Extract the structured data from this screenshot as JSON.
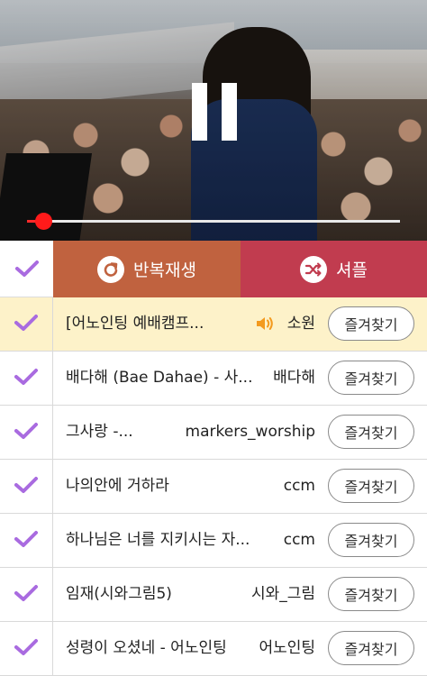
{
  "player": {
    "progress_fraction": 0.043
  },
  "controls": {
    "repeat_label": "반복재생",
    "shuffle_label": "셔플",
    "repeat_color": "#c0623f",
    "shuffle_color": "#c13c4f",
    "check_color": "#a96be0"
  },
  "tracks": [
    {
      "title": "[어노인팅 예배캠프...",
      "artist": "소원",
      "fav_label": "즐겨찾기",
      "active": true
    },
    {
      "title": "배다해 (Bae Dahae) - 사...",
      "artist": "배다해",
      "fav_label": "즐겨찾기"
    },
    {
      "title": "그사랑 -...",
      "artist": "markers_worship",
      "fav_label": "즐겨찾기"
    },
    {
      "title": "나의안에 거하라",
      "artist": "ccm",
      "fav_label": "즐겨찾기"
    },
    {
      "title": "하나님은 너를 지키시는 자...",
      "artist": "ccm",
      "fav_label": "즐겨찾기"
    },
    {
      "title": "임재(시와그림5)",
      "artist": "시와_그림",
      "fav_label": "즐겨찾기"
    },
    {
      "title": "성령이 오셨네 - 어노인팅",
      "artist": "어노인팅",
      "fav_label": "즐겨찾기"
    }
  ]
}
